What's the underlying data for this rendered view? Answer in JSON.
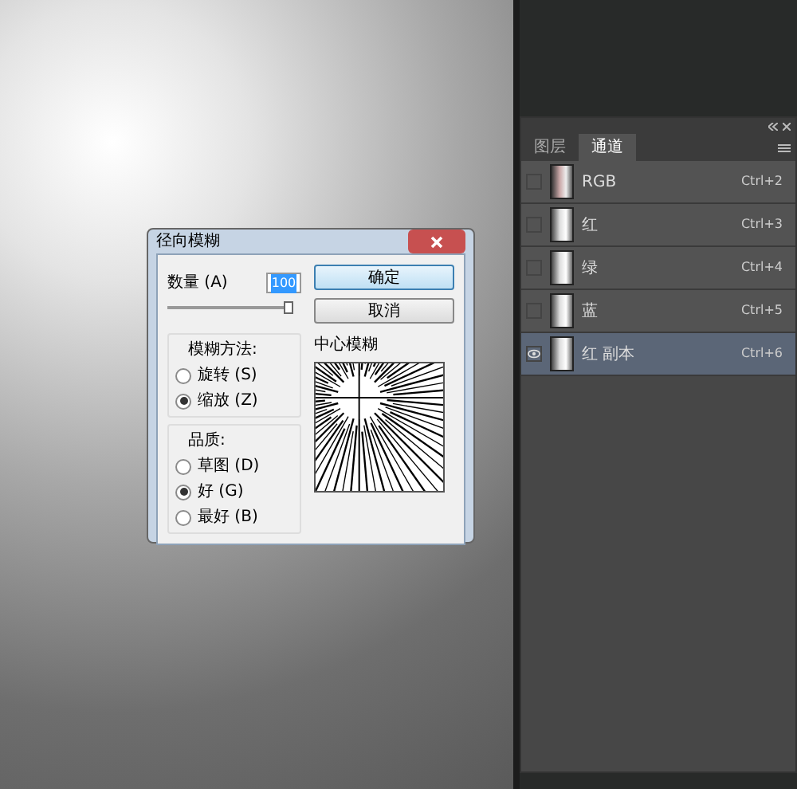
{
  "panel": {
    "tabs": [
      {
        "label": "图层",
        "selected": false
      },
      {
        "label": "通道",
        "selected": true
      }
    ],
    "channels": [
      {
        "name": "RGB",
        "shortcut": "Ctrl+2",
        "visible": false,
        "selected": false
      },
      {
        "name": "红",
        "shortcut": "Ctrl+3",
        "visible": false,
        "selected": false
      },
      {
        "name": "绿",
        "shortcut": "Ctrl+4",
        "visible": false,
        "selected": false
      },
      {
        "name": "蓝",
        "shortcut": "Ctrl+5",
        "visible": false,
        "selected": false
      },
      {
        "name": "红 副本",
        "shortcut": "Ctrl+6",
        "visible": true,
        "selected": true
      }
    ]
  },
  "dialog": {
    "title": "径向模糊",
    "amount": {
      "label": "数量 (A)",
      "value": "100",
      "level": 1
    },
    "buttons": [
      "确定",
      "取消"
    ],
    "method": {
      "title": "模糊方法:",
      "options": [
        {
          "label": "旋转 (S)",
          "selected": false
        },
        {
          "label": "缩放 (Z)",
          "selected": true
        }
      ]
    },
    "quality": {
      "title": "品质:",
      "options": [
        {
          "label": "草图 (D)",
          "selected": false
        },
        {
          "label": "好 (G)",
          "selected": true
        },
        {
          "label": "最好 (B)",
          "selected": false
        }
      ]
    },
    "preview": {
      "title": "中心模糊"
    }
  }
}
